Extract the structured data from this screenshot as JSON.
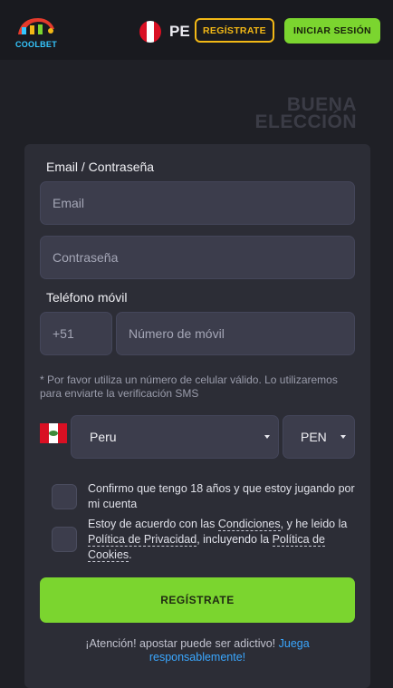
{
  "header": {
    "logo_text": "COOLBET",
    "country_code": "PE",
    "register_label": "REGÍSTRATE",
    "login_label": "INICIAR SESIÓN"
  },
  "hero": {
    "line1": "BUENA",
    "line2": "ELECCIÓN"
  },
  "form": {
    "email_section_label": "Email / Contraseña",
    "email_placeholder": "Email",
    "password_placeholder": "Contraseña",
    "phone_section_label": "Teléfono móvil",
    "phone_prefix": "+51",
    "phone_placeholder": "Número de móvil",
    "phone_note": "* Por favor utiliza un número de celular válido. Lo utilizaremos para enviarte la verificación SMS",
    "country_selected": "Peru",
    "currency_selected": "PEN",
    "age_check_text": "Confirmo que tengo 18 años y que estoy jugando por mi cuenta",
    "terms_prefix": "Estoy de acuerdo con las ",
    "terms_link": "Condiciones",
    "terms_mid": ", y he leido la ",
    "privacy_link": "Política de Privacidad",
    "terms_mid2": ", incluyendo la ",
    "cookies_link": "Política de Cookies",
    "terms_end": ".",
    "submit_label": "REGÍSTRATE",
    "warning_text": "¡Atención! apostar puede ser adictivo! ",
    "warning_link": "Juega responsablemente!"
  },
  "colors": {
    "accent_green": "#7bd52f",
    "accent_yellow": "#f2b816",
    "link_blue": "#3aa7ff",
    "flag_red": "#d91023"
  }
}
